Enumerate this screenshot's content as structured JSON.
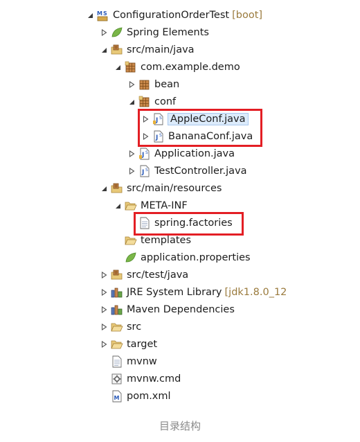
{
  "tree": {
    "project": {
      "label": "ConfigurationOrderTest",
      "suffix": "[boot]"
    },
    "items": [
      {
        "label": "Spring Elements"
      },
      {
        "label": "src/main/java"
      },
      {
        "label": "com.example.demo"
      },
      {
        "label": "bean"
      },
      {
        "label": "conf"
      },
      {
        "label": "AppleConf.java"
      },
      {
        "label": "BananaConf.java"
      },
      {
        "label": "Application.java"
      },
      {
        "label": "TestController.java"
      },
      {
        "label": "src/main/resources"
      },
      {
        "label": "META-INF"
      },
      {
        "label": "spring.factories"
      },
      {
        "label": "templates"
      },
      {
        "label": "application.properties"
      },
      {
        "label": "src/test/java"
      },
      {
        "label": "JRE System Library",
        "suffix": "[jdk1.8.0_12"
      },
      {
        "label": "Maven Dependencies"
      },
      {
        "label": "src"
      },
      {
        "label": "target"
      },
      {
        "label": "mvnw"
      },
      {
        "label": "mvnw.cmd"
      },
      {
        "label": "pom.xml"
      }
    ]
  },
  "caption": "目录结构"
}
